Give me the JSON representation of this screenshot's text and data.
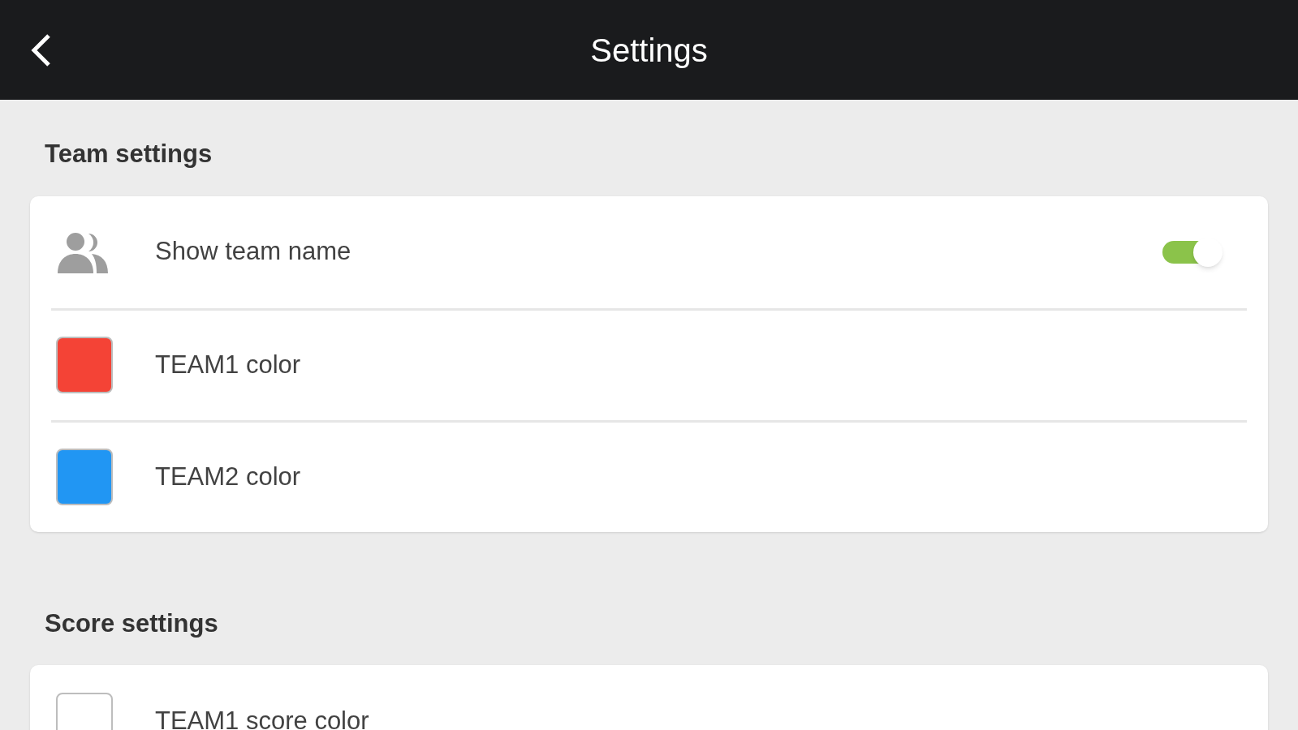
{
  "header": {
    "title": "Settings"
  },
  "sections": [
    {
      "title": "Team settings",
      "rows": [
        {
          "kind": "toggle",
          "label": "Show team name",
          "on": true
        },
        {
          "kind": "color",
          "label": "TEAM1 color",
          "color": "#f44336"
        },
        {
          "kind": "color",
          "label": "TEAM2 color",
          "color": "#2196f3"
        }
      ]
    },
    {
      "title": "Score settings",
      "rows": [
        {
          "kind": "color",
          "label": "TEAM1 score color",
          "color": "#ffffff"
        }
      ]
    }
  ]
}
